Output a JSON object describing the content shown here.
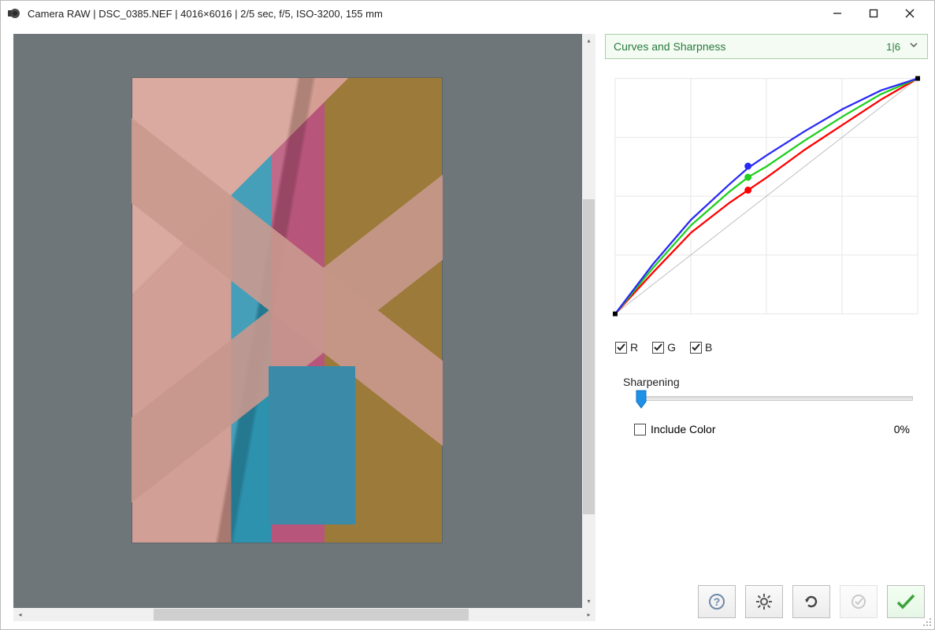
{
  "window": {
    "title": "Camera RAW | DSC_0385.NEF | 4016×6016 | 2/5 sec, f/5, ISO-3200, 155 mm"
  },
  "panel": {
    "title": "Curves and Sharpness",
    "index": "1|6"
  },
  "channels": {
    "r": {
      "label": "R",
      "checked": true
    },
    "g": {
      "label": "G",
      "checked": true
    },
    "b": {
      "label": "B",
      "checked": true
    }
  },
  "sharpening": {
    "label": "Sharpening",
    "value": 0,
    "include_color_label": "Include Color",
    "include_color_checked": false,
    "percent_text": "0%"
  },
  "chart_data": {
    "type": "line",
    "title": "",
    "xlabel": "",
    "ylabel": "",
    "xlim": [
      0,
      255
    ],
    "ylim": [
      0,
      255
    ],
    "grid": true,
    "series": [
      {
        "name": "diagonal",
        "color": "#bfbfbf",
        "points": [
          [
            0,
            0
          ],
          [
            255,
            255
          ]
        ]
      },
      {
        "name": "R",
        "color": "#ff0000",
        "points": [
          [
            0,
            0
          ],
          [
            32,
            45
          ],
          [
            64,
            88
          ],
          [
            96,
            120
          ],
          [
            112,
            134
          ],
          [
            128,
            148
          ],
          [
            160,
            178
          ],
          [
            192,
            205
          ],
          [
            224,
            232
          ],
          [
            255,
            255
          ]
        ],
        "control_point": [
          112,
          134
        ]
      },
      {
        "name": "G",
        "color": "#1fcf1f",
        "points": [
          [
            0,
            0
          ],
          [
            32,
            50
          ],
          [
            64,
            96
          ],
          [
            96,
            132
          ],
          [
            112,
            148
          ],
          [
            128,
            160
          ],
          [
            160,
            188
          ],
          [
            192,
            214
          ],
          [
            224,
            238
          ],
          [
            255,
            255
          ]
        ],
        "control_point": [
          112,
          148
        ]
      },
      {
        "name": "B",
        "color": "#2a2af5",
        "points": [
          [
            0,
            0
          ],
          [
            32,
            54
          ],
          [
            64,
            102
          ],
          [
            96,
            140
          ],
          [
            112,
            158
          ],
          [
            128,
            172
          ],
          [
            160,
            198
          ],
          [
            192,
            222
          ],
          [
            224,
            242
          ],
          [
            255,
            255
          ]
        ],
        "control_point": [
          112,
          160
        ]
      }
    ]
  },
  "icons": {
    "help": "help-icon",
    "settings": "gear-icon",
    "reset": "refresh-icon",
    "auto": "target-check-icon",
    "apply": "check-icon"
  }
}
